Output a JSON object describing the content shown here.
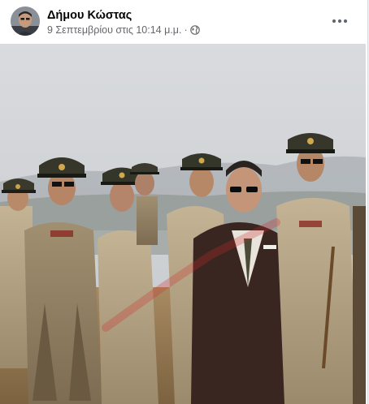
{
  "post": {
    "author": {
      "name": "Δήμου Κώστας",
      "avatar_icon": "profile-photo"
    },
    "timestamp": "9 Σεπτεμβρίου στις 10:14 μ.μ.",
    "separator": "·",
    "audience_icon": "globe-icon",
    "more_icon": "more-horizontal-icon",
    "photo": {
      "kind": "photograph",
      "subject": "military officers in khaki uniforms and peaked caps walking outdoors with a man in a dark suit and sunglasses",
      "watermark": "diagonal faded red text watermark"
    }
  },
  "colors": {
    "name_text": "#050505",
    "meta_text": "#65676b",
    "card_bg": "#ffffff",
    "page_bg": "#eef0f3"
  }
}
